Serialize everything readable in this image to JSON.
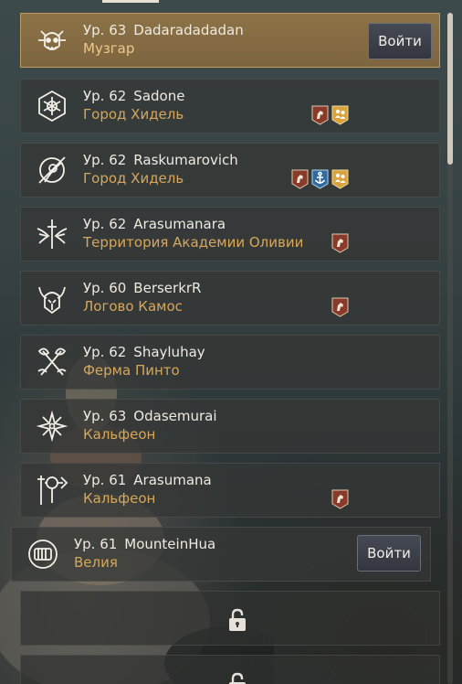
{
  "characters": [
    {
      "level": "Ур. 63",
      "name": "Dadaradadadan",
      "location": "Музгар",
      "emblem": "dragon-skull-icon",
      "badges": [],
      "enter_label": "Войти"
    },
    {
      "level": "Ур. 62",
      "name": "Sadone",
      "location": "Город Хидель",
      "emblem": "mandala-shield-icon",
      "badges": [
        "horse-badge-icon",
        "family-badge-icon"
      ]
    },
    {
      "level": "Ур. 62",
      "name": "Raskumarovich",
      "location": "Город Хидель",
      "emblem": "crossed-blade-circle-icon",
      "badges": [
        "horse-badge-icon",
        "anchor-badge-icon",
        "family-badge-icon"
      ]
    },
    {
      "level": "Ур. 62",
      "name": "Arasumanara",
      "location": "Территория Академии Оливии",
      "emblem": "winged-sword-icon",
      "badges": [
        "horse-badge-icon"
      ]
    },
    {
      "level": "Ур. 60",
      "name": "BerserkrR",
      "location": "Логово Камос",
      "emblem": "horned-helmet-icon",
      "badges": [
        "horse-badge-icon"
      ]
    },
    {
      "level": "Ур. 62",
      "name": "Shayluhay",
      "location": "Ферма Пинто",
      "emblem": "crossed-axes-icon",
      "badges": []
    },
    {
      "level": "Ур. 63",
      "name": "Odasemurai",
      "location": "Кальфеон",
      "emblem": "shuriken-star-icon",
      "badges": []
    },
    {
      "level": "Ур. 61",
      "name": "Arasumana",
      "location": "Кальфеон",
      "emblem": "hammer-lance-icon",
      "badges": [
        "horse-badge-icon"
      ]
    },
    {
      "level": "Ур. 61",
      "name": "MounteinHua",
      "location": "Велия",
      "emblem": "fist-circle-icon",
      "badges": [],
      "enter_label": "Войти"
    }
  ],
  "locked_slots": [
    "lock-icon",
    "lock-icon"
  ],
  "colors": {
    "selected_card": "#8c7246",
    "location_text": "#d7a75a",
    "horse_badge": "#8a3a2a",
    "anchor_badge": "#2f6aa0",
    "family_badge": "#d9a23a"
  }
}
